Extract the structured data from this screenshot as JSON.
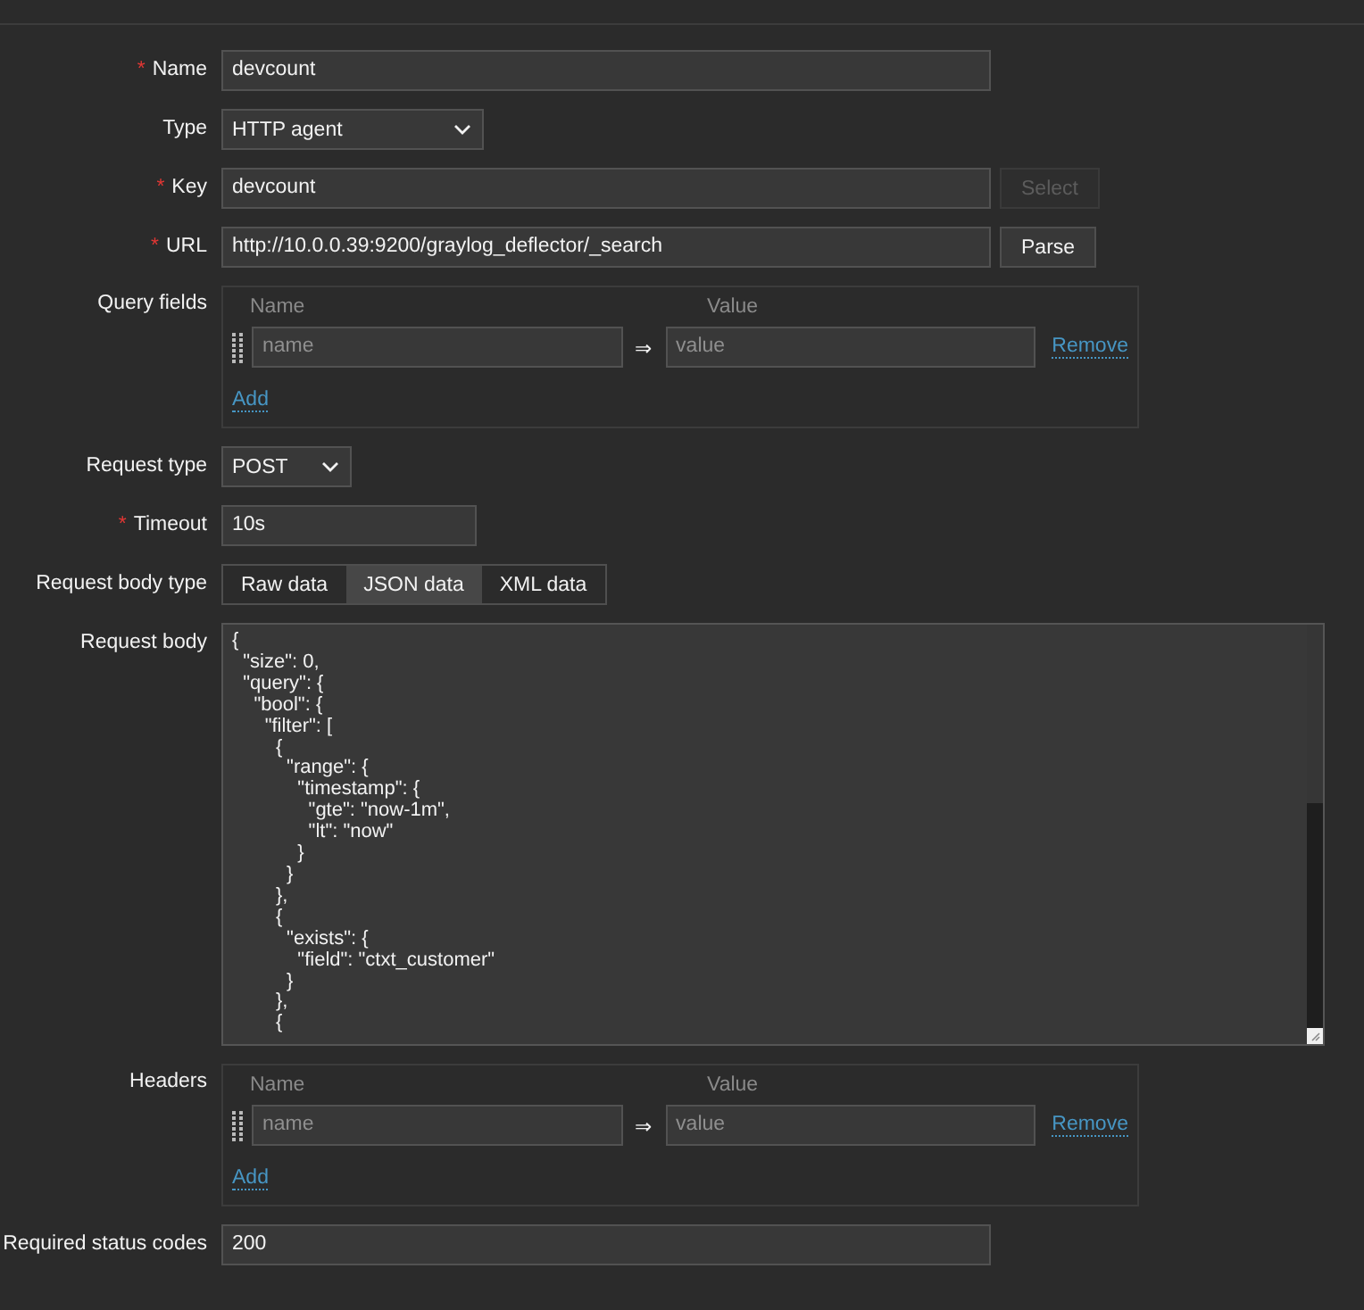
{
  "fields": [
    {
      "kind": "text",
      "label": "Name",
      "marker": "*",
      "value": "devcount"
    },
    {
      "kind": "select",
      "label": "Type",
      "value": "HTTP agent"
    },
    {
      "kind": "text",
      "label": "Key",
      "marker": "*",
      "value": "devcount",
      "button": {
        "label": "Select",
        "disabled": true
      }
    },
    {
      "kind": "text",
      "label": "URL",
      "marker": "*",
      "value": "http://10.0.0.39:9200/graylog_deflector/_search",
      "button": {
        "label": "Parse",
        "disabled": false
      }
    },
    {
      "kind": "pairs",
      "label": "Query fields",
      "name_header": "Name",
      "value_header": "Value",
      "rows": [
        {
          "name_placeholder": "name",
          "arrow": "⇒",
          "value_placeholder": "value",
          "remove": "Remove"
        }
      ],
      "add": "Add"
    },
    {
      "kind": "select",
      "label": "Request type",
      "value": "POST"
    },
    {
      "kind": "text",
      "label": "Timeout",
      "marker": "*",
      "value": "10s"
    },
    {
      "kind": "segmented",
      "label": "Request body type",
      "options": [
        {
          "label": "Raw data",
          "selected": false
        },
        {
          "label": "JSON data",
          "selected": true
        },
        {
          "label": "XML data",
          "selected": false
        }
      ]
    },
    {
      "kind": "textarea",
      "label": "Request body",
      "value": "{\n  \"size\": 0,\n  \"query\": {\n    \"bool\": {\n      \"filter\": [\n        {\n          \"range\": {\n            \"timestamp\": {\n              \"gte\": \"now-1m\",\n              \"lt\": \"now\"\n            }\n          }\n        },\n        {\n          \"exists\": {\n            \"field\": \"ctxt_customer\"\n          }\n        },\n        {"
    },
    {
      "kind": "pairs",
      "label": "Headers",
      "name_header": "Name",
      "value_header": "Value",
      "rows": [
        {
          "name_placeholder": "name",
          "arrow": "⇒",
          "value_placeholder": "value",
          "remove": "Remove"
        }
      ],
      "add": "Add"
    },
    {
      "kind": "text",
      "label": "Required status codes",
      "value": "200"
    }
  ]
}
